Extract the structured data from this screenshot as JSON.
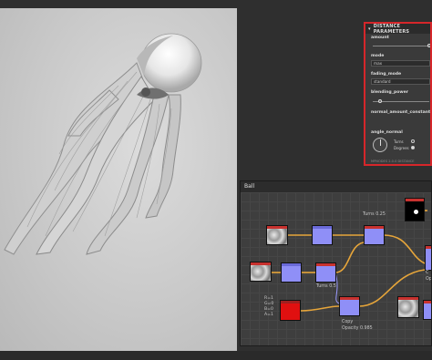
{
  "parameters_panel": {
    "title": "DISTANCE PARAMETERS",
    "amount_label": "amount",
    "mode_label": "mode",
    "mode_value": "max",
    "fading_mode_label": "fading_mode",
    "fading_mode_value": "standard",
    "blending_power_label": "blending_power",
    "normal_amount_constant_label": "normal_amount_constant",
    "angle_normal_label": "angle_normal",
    "angle_options": [
      "Turns",
      "Degrees"
    ],
    "angle_selected": "Degrees",
    "footer": "MPNODES 2.0.0 DISTANCE"
  },
  "graph_panel": {
    "title": "Ball",
    "labels": {
      "turns_top": "Turns 0.25",
      "turns_mid": "Turns 0.5",
      "copy": "Copy",
      "opacity": "Opacity 0.985",
      "rgba": [
        "R=1",
        "G=0",
        "B=0",
        "A=1"
      ],
      "right_cut": "C",
      "right_cut2": "Op"
    }
  },
  "colors": {
    "accent_red": "#d6262a",
    "node_blue": "#8f8ff7",
    "wire_orange": "#e6a53a",
    "node_red": "#e01010"
  }
}
